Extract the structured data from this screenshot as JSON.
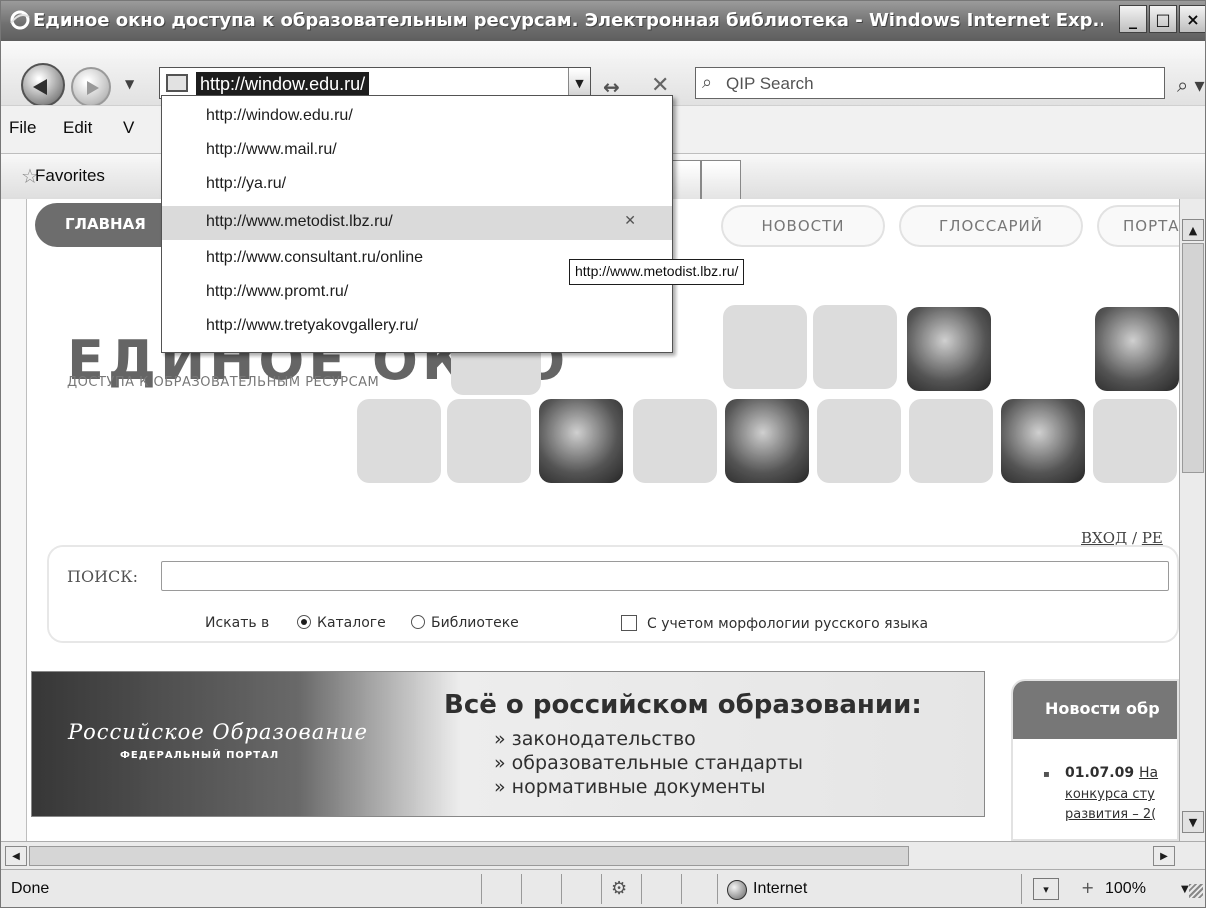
{
  "window": {
    "title": "Единое окно доступа к образовательным ресурсам. Электронная библиотека - Windows Internet Exp...",
    "buttons": {
      "minimize": "_",
      "maximize": "□",
      "close": "×"
    }
  },
  "address_bar": {
    "url": "http://window.edu.ru/",
    "search_placeholder": "QIP Search"
  },
  "menu": {
    "items": [
      {
        "label": "File",
        "accel": "F"
      },
      {
        "label": "Edit",
        "accel": "E"
      },
      {
        "label": "V",
        "accel": "V"
      }
    ]
  },
  "favorites": {
    "label": "Favorites"
  },
  "url_dropdown": {
    "items": [
      "http://window.edu.ru/",
      "http://www.mail.ru/",
      "http://ya.ru/",
      "http://www.metodist.lbz.ru/",
      "http://www.consultant.ru/online",
      "http://www.promt.ru/",
      "http://www.tretyakovgallery.ru/"
    ],
    "highlighted_index": 3,
    "tooltip": "http://www.metodist.lbz.ru/"
  },
  "site": {
    "nav": {
      "main": "ГЛАВНАЯ",
      "news": "НОВОСТИ",
      "glossary": "ГЛОССАРИЙ",
      "portal": "ПОРТА"
    },
    "logo_title": "ЕДИНОЕ ОКНО",
    "logo_subtitle": "ДОСТУПА К ОБРАЗОВАТЕЛЬНЫМ РЕСУРСАМ",
    "login": {
      "enter": "ВХОД",
      "sep": "/",
      "register": "РЕ"
    },
    "search": {
      "label": "ПОИСК:",
      "search_in": "Искать в",
      "option_catalog": "Каталоге",
      "option_library": "Библиотеке",
      "morphology": "С учетом морфологии русского языка",
      "selected": "catalog"
    },
    "banner": {
      "logo": "Российское Образование",
      "logo_sub": "ФЕДЕРАЛЬНЫЙ ПОРТАЛ",
      "title": "Всё о российском образовании:",
      "items": [
        "» законодательство",
        "» образовательные стандарты",
        "» нормативные документы"
      ]
    },
    "news": {
      "header": "Новости обр",
      "date": "01.07.09",
      "text_start": "На",
      "lines": [
        "конкурса сту",
        "развития – 2("
      ]
    }
  },
  "status_bar": {
    "text": "Done",
    "zone": "Internet",
    "zoom": "100%"
  }
}
